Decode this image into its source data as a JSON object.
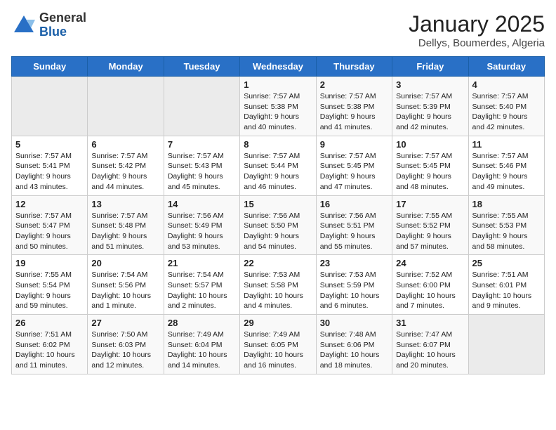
{
  "header": {
    "logo_general": "General",
    "logo_blue": "Blue",
    "title": "January 2025",
    "subtitle": "Dellys, Boumerdes, Algeria"
  },
  "weekdays": [
    "Sunday",
    "Monday",
    "Tuesday",
    "Wednesday",
    "Thursday",
    "Friday",
    "Saturday"
  ],
  "weeks": [
    [
      {
        "day": "",
        "content": "",
        "empty": true
      },
      {
        "day": "",
        "content": "",
        "empty": true
      },
      {
        "day": "",
        "content": "",
        "empty": true
      },
      {
        "day": "1",
        "content": "Sunrise: 7:57 AM\nSunset: 5:38 PM\nDaylight: 9 hours and 40 minutes.",
        "empty": false
      },
      {
        "day": "2",
        "content": "Sunrise: 7:57 AM\nSunset: 5:38 PM\nDaylight: 9 hours and 41 minutes.",
        "empty": false
      },
      {
        "day": "3",
        "content": "Sunrise: 7:57 AM\nSunset: 5:39 PM\nDaylight: 9 hours and 42 minutes.",
        "empty": false
      },
      {
        "day": "4",
        "content": "Sunrise: 7:57 AM\nSunset: 5:40 PM\nDaylight: 9 hours and 42 minutes.",
        "empty": false
      }
    ],
    [
      {
        "day": "5",
        "content": "Sunrise: 7:57 AM\nSunset: 5:41 PM\nDaylight: 9 hours and 43 minutes.",
        "empty": false
      },
      {
        "day": "6",
        "content": "Sunrise: 7:57 AM\nSunset: 5:42 PM\nDaylight: 9 hours and 44 minutes.",
        "empty": false
      },
      {
        "day": "7",
        "content": "Sunrise: 7:57 AM\nSunset: 5:43 PM\nDaylight: 9 hours and 45 minutes.",
        "empty": false
      },
      {
        "day": "8",
        "content": "Sunrise: 7:57 AM\nSunset: 5:44 PM\nDaylight: 9 hours and 46 minutes.",
        "empty": false
      },
      {
        "day": "9",
        "content": "Sunrise: 7:57 AM\nSunset: 5:45 PM\nDaylight: 9 hours and 47 minutes.",
        "empty": false
      },
      {
        "day": "10",
        "content": "Sunrise: 7:57 AM\nSunset: 5:45 PM\nDaylight: 9 hours and 48 minutes.",
        "empty": false
      },
      {
        "day": "11",
        "content": "Sunrise: 7:57 AM\nSunset: 5:46 PM\nDaylight: 9 hours and 49 minutes.",
        "empty": false
      }
    ],
    [
      {
        "day": "12",
        "content": "Sunrise: 7:57 AM\nSunset: 5:47 PM\nDaylight: 9 hours and 50 minutes.",
        "empty": false
      },
      {
        "day": "13",
        "content": "Sunrise: 7:57 AM\nSunset: 5:48 PM\nDaylight: 9 hours and 51 minutes.",
        "empty": false
      },
      {
        "day": "14",
        "content": "Sunrise: 7:56 AM\nSunset: 5:49 PM\nDaylight: 9 hours and 53 minutes.",
        "empty": false
      },
      {
        "day": "15",
        "content": "Sunrise: 7:56 AM\nSunset: 5:50 PM\nDaylight: 9 hours and 54 minutes.",
        "empty": false
      },
      {
        "day": "16",
        "content": "Sunrise: 7:56 AM\nSunset: 5:51 PM\nDaylight: 9 hours and 55 minutes.",
        "empty": false
      },
      {
        "day": "17",
        "content": "Sunrise: 7:55 AM\nSunset: 5:52 PM\nDaylight: 9 hours and 57 minutes.",
        "empty": false
      },
      {
        "day": "18",
        "content": "Sunrise: 7:55 AM\nSunset: 5:53 PM\nDaylight: 9 hours and 58 minutes.",
        "empty": false
      }
    ],
    [
      {
        "day": "19",
        "content": "Sunrise: 7:55 AM\nSunset: 5:54 PM\nDaylight: 9 hours and 59 minutes.",
        "empty": false
      },
      {
        "day": "20",
        "content": "Sunrise: 7:54 AM\nSunset: 5:56 PM\nDaylight: 10 hours and 1 minute.",
        "empty": false
      },
      {
        "day": "21",
        "content": "Sunrise: 7:54 AM\nSunset: 5:57 PM\nDaylight: 10 hours and 2 minutes.",
        "empty": false
      },
      {
        "day": "22",
        "content": "Sunrise: 7:53 AM\nSunset: 5:58 PM\nDaylight: 10 hours and 4 minutes.",
        "empty": false
      },
      {
        "day": "23",
        "content": "Sunrise: 7:53 AM\nSunset: 5:59 PM\nDaylight: 10 hours and 6 minutes.",
        "empty": false
      },
      {
        "day": "24",
        "content": "Sunrise: 7:52 AM\nSunset: 6:00 PM\nDaylight: 10 hours and 7 minutes.",
        "empty": false
      },
      {
        "day": "25",
        "content": "Sunrise: 7:51 AM\nSunset: 6:01 PM\nDaylight: 10 hours and 9 minutes.",
        "empty": false
      }
    ],
    [
      {
        "day": "26",
        "content": "Sunrise: 7:51 AM\nSunset: 6:02 PM\nDaylight: 10 hours and 11 minutes.",
        "empty": false
      },
      {
        "day": "27",
        "content": "Sunrise: 7:50 AM\nSunset: 6:03 PM\nDaylight: 10 hours and 12 minutes.",
        "empty": false
      },
      {
        "day": "28",
        "content": "Sunrise: 7:49 AM\nSunset: 6:04 PM\nDaylight: 10 hours and 14 minutes.",
        "empty": false
      },
      {
        "day": "29",
        "content": "Sunrise: 7:49 AM\nSunset: 6:05 PM\nDaylight: 10 hours and 16 minutes.",
        "empty": false
      },
      {
        "day": "30",
        "content": "Sunrise: 7:48 AM\nSunset: 6:06 PM\nDaylight: 10 hours and 18 minutes.",
        "empty": false
      },
      {
        "day": "31",
        "content": "Sunrise: 7:47 AM\nSunset: 6:07 PM\nDaylight: 10 hours and 20 minutes.",
        "empty": false
      },
      {
        "day": "",
        "content": "",
        "empty": true
      }
    ]
  ]
}
